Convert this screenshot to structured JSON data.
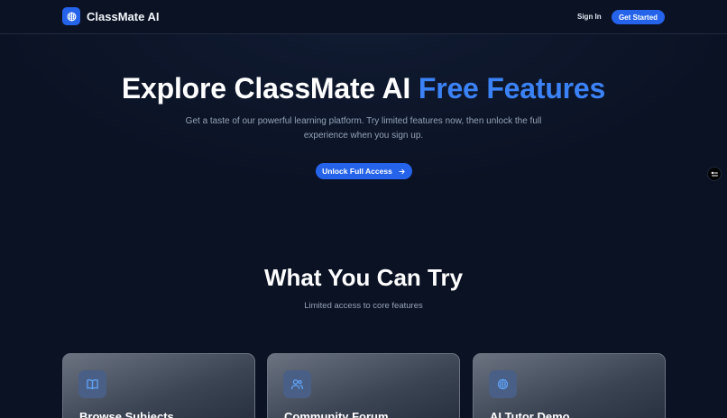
{
  "nav": {
    "brand": "ClassMate AI",
    "signin_label": "Sign In",
    "get_started_label": "Get Started"
  },
  "hero": {
    "title_main": "Explore ClassMate AI",
    "title_accent": "Free Features",
    "subtitle": "Get a taste of our powerful learning platform. Try limited features now, then unlock the full experience when you sign up.",
    "cta_label": "Unlock Full Access"
  },
  "section": {
    "title": "What You Can Try",
    "subtitle": "Limited access to core features"
  },
  "cards": [
    {
      "title": "Browse Subjects",
      "icon": "book-icon"
    },
    {
      "title": "Community Forum",
      "icon": "users-icon"
    },
    {
      "title": "AI Tutor Demo",
      "icon": "brain-icon"
    }
  ],
  "colors": {
    "background": "#0b1224",
    "accent": "#3b82f6",
    "button": "#2563eb",
    "muted_text": "#94a3b8"
  }
}
